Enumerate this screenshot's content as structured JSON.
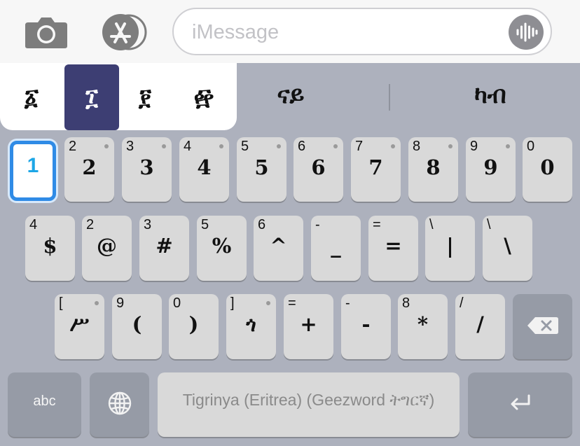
{
  "message_bar": {
    "placeholder": "iMessage",
    "icons": [
      "camera-icon",
      "app-store-icon",
      "voice-waveform-icon"
    ]
  },
  "popup": {
    "keys": [
      "፩",
      "፲",
      "፻",
      "፼"
    ],
    "selected_index": 1
  },
  "candidates": [
    "ናይ",
    "ካብ"
  ],
  "rows": [
    [
      {
        "hint": "",
        "main": "1",
        "highlighted": true
      },
      {
        "hint": "2",
        "main": "2",
        "dot": true
      },
      {
        "hint": "3",
        "main": "3",
        "dot": true
      },
      {
        "hint": "4",
        "main": "4",
        "dot": true
      },
      {
        "hint": "5",
        "main": "5",
        "dot": true
      },
      {
        "hint": "6",
        "main": "6",
        "dot": true
      },
      {
        "hint": "7",
        "main": "7",
        "dot": true
      },
      {
        "hint": "8",
        "main": "8",
        "dot": true
      },
      {
        "hint": "9",
        "main": "9",
        "dot": true
      },
      {
        "hint": "0",
        "main": "0",
        "dot": false
      }
    ],
    [
      {
        "hint": "4",
        "main": "$"
      },
      {
        "hint": "2",
        "main": "@"
      },
      {
        "hint": "3",
        "main": "#"
      },
      {
        "hint": "5",
        "main": "%"
      },
      {
        "hint": "6",
        "main": "^"
      },
      {
        "hint": "-",
        "main": "_"
      },
      {
        "hint": "=",
        "main": "="
      },
      {
        "hint": "\\",
        "main": "|"
      },
      {
        "hint": "\\",
        "main": "\\"
      }
    ],
    [
      {
        "hint": "[",
        "main": "ሥ",
        "dot": true
      },
      {
        "hint": "9",
        "main": "("
      },
      {
        "hint": "0",
        "main": ")"
      },
      {
        "hint": "]",
        "main": "ጎ",
        "dot": true
      },
      {
        "hint": "=",
        "main": "+"
      },
      {
        "hint": "-",
        "main": "-"
      },
      {
        "hint": "8",
        "main": "*"
      },
      {
        "hint": "/",
        "main": "/"
      }
    ]
  ],
  "bottom": {
    "abc_label": "abc",
    "space_label": "Tigrinya (Eritrea) (Geezword ትግርኛ)",
    "icons": [
      "globe-icon",
      "return-icon",
      "delete-icon"
    ]
  }
}
